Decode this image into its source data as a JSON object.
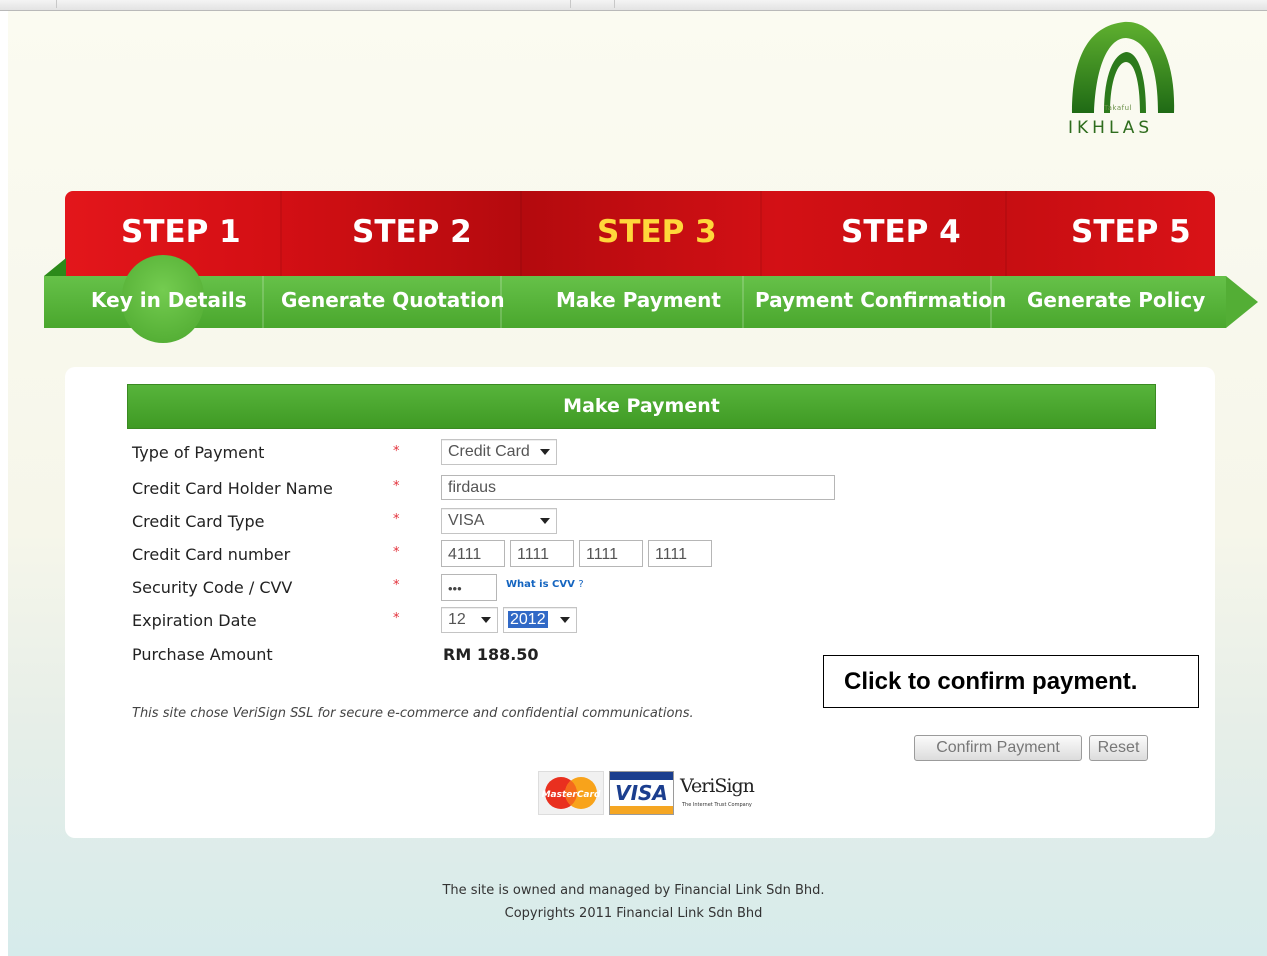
{
  "brand": {
    "name": "IKHLAS",
    "tagline": "Takaful"
  },
  "steps": [
    {
      "title": "STEP 1",
      "label": "Key in Details"
    },
    {
      "title": "STEP 2",
      "label": "Generate Quotation"
    },
    {
      "title": "STEP 3",
      "label": "Make Payment"
    },
    {
      "title": "STEP 4",
      "label": "Payment Confirmation"
    },
    {
      "title": "STEP 5",
      "label": "Generate Policy"
    }
  ],
  "active_step": 3,
  "form": {
    "title": "Make Payment",
    "required_mark": "*",
    "fields": {
      "payment_type": {
        "label": "Type of Payment",
        "value": "Credit Card"
      },
      "holder_name": {
        "label": "Credit Card Holder Name",
        "value": "firdaus"
      },
      "card_type": {
        "label": "Credit Card Type",
        "value": "VISA"
      },
      "card_number": {
        "label": "Credit Card number",
        "parts": [
          "4111",
          "1111",
          "1111",
          "1111"
        ]
      },
      "cvv": {
        "label": "Security Code / CVV",
        "value": "•••",
        "help_link": "What is CVV",
        "help_mark": "?"
      },
      "expiry": {
        "label": "Expiration Date",
        "month": "12",
        "year": "2012"
      },
      "amount": {
        "label": "Purchase Amount",
        "value": "RM 188.50"
      }
    },
    "ssl_notice": "This site chose VeriSign SSL for secure e-commerce and confidential communications.",
    "confirm_label": "Confirm Payment",
    "reset_label": "Reset"
  },
  "callout": "Click to confirm payment.",
  "badges": {
    "mastercard": "MasterCard",
    "visa": "VISA",
    "verisign": "VeriSign",
    "verisign_sub": "The Internet Trust Company"
  },
  "footer": {
    "line1": "The site is owned and managed by Financial Link Sdn Bhd.",
    "line2": "Copyrights 2011 Financial Link Sdn Bhd"
  },
  "colors": {
    "step_red": "#d40f14",
    "step_green": "#4ca72e",
    "active_step_text": "#ffd73b",
    "required": "#e3303a"
  }
}
